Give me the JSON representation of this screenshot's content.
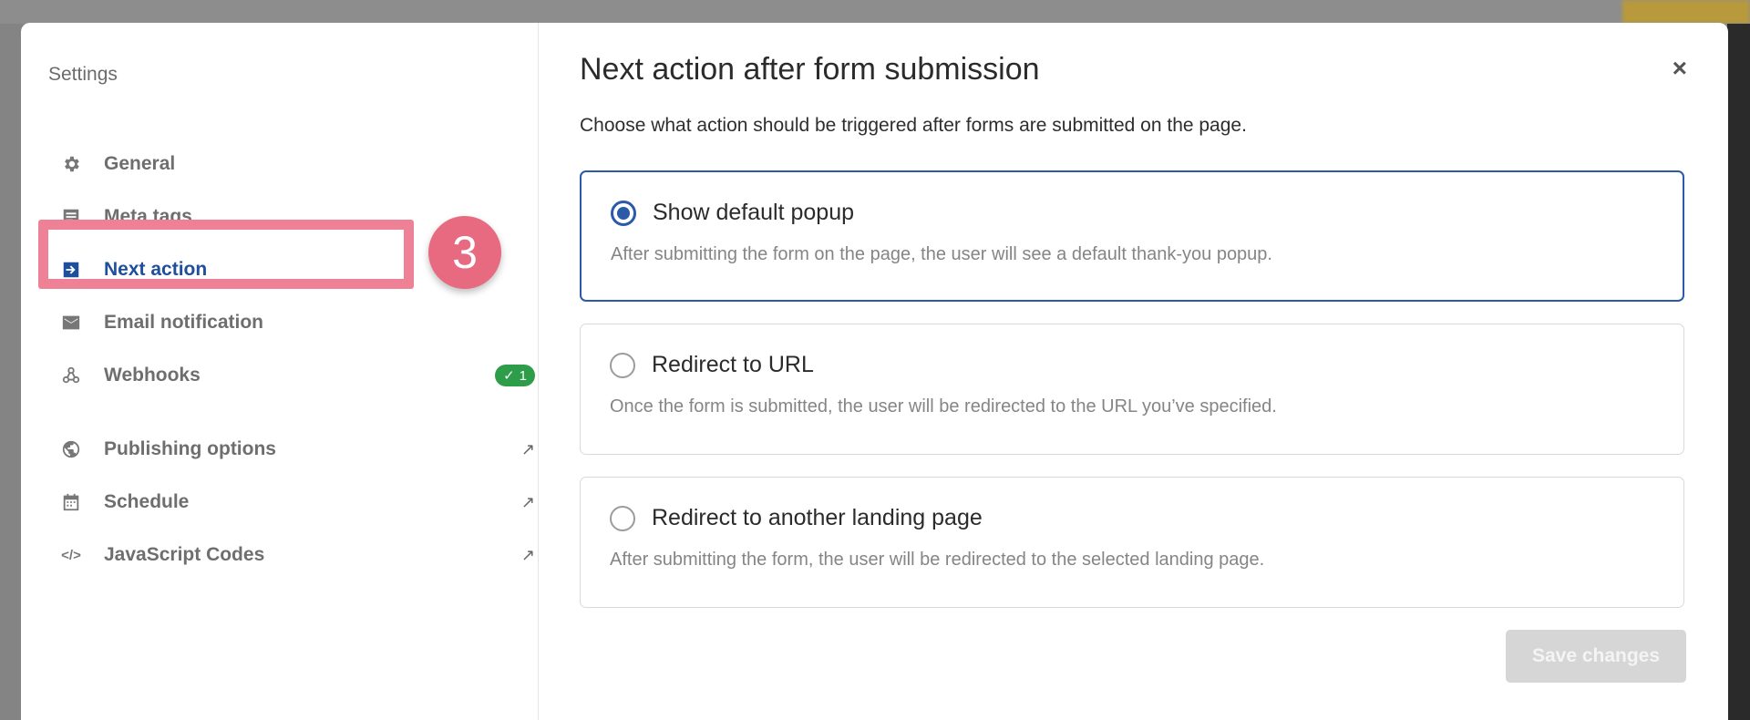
{
  "sidebar": {
    "title": "Settings",
    "items": [
      {
        "label": "General",
        "icon": "gear-icon"
      },
      {
        "label": "Meta tags",
        "icon": "document-icon"
      },
      {
        "label": "Next action",
        "icon": "arrow-right-icon",
        "active": true
      },
      {
        "label": "Email notification",
        "icon": "envelope-icon"
      },
      {
        "label": "Webhooks",
        "icon": "webhook-icon",
        "badge": "1"
      },
      {
        "label": "Publishing options",
        "icon": "globe-icon",
        "external": true
      },
      {
        "label": "Schedule",
        "icon": "calendar-icon",
        "external": true
      },
      {
        "label": "JavaScript Codes",
        "icon": "code-icon",
        "external": true
      }
    ]
  },
  "step_marker": "3",
  "main": {
    "title": "Next action after form submission",
    "description": "Choose what action should be triggered after forms are submitted on the page.",
    "options": [
      {
        "label": "Show default popup",
        "description": "After submitting the form on the page, the user will see a default thank-you popup.",
        "selected": true
      },
      {
        "label": "Redirect to URL",
        "description": "Once the form is submitted, the user will be redirected to the URL you’ve specified.",
        "selected": false
      },
      {
        "label": "Redirect to another landing page",
        "description": "After submitting the form, the user will be redirected to the selected landing page.",
        "selected": false
      }
    ],
    "save_label": "Save changes",
    "close_label": "×"
  },
  "colors": {
    "accent": "#2a5aa8",
    "highlight": "#ee8196",
    "badge": "#2e9d4a"
  }
}
